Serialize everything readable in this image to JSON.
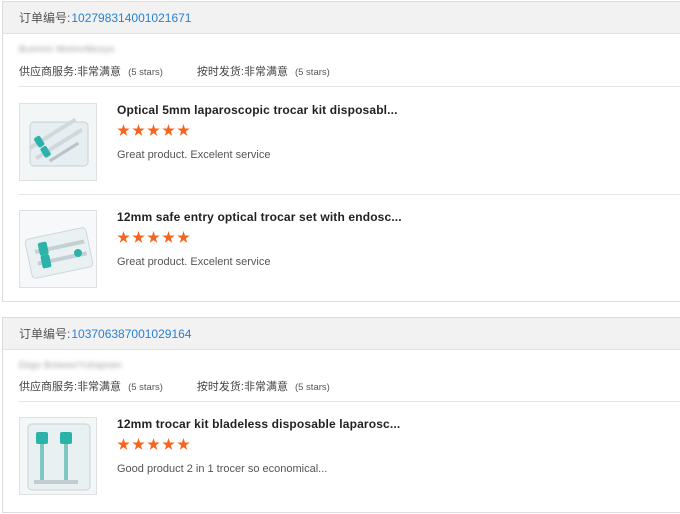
{
  "orders": [
    {
      "label": "订单编号:",
      "number": "102798314001021671",
      "buyer": "Buiimiin Motim/Mosyo",
      "supplier_label": "供应商服务:",
      "supplier_value": "非常满意",
      "supplier_stars": "(5 stars)",
      "delivery_label": "按时发货:",
      "delivery_value": "非常满意",
      "delivery_stars": "(5 stars)",
      "items": [
        {
          "title": "Optical 5mm laparoscopic trocar kit disposabl...",
          "rating": 5,
          "comment": "Great product. Excelent service"
        },
        {
          "title": "12mm safe entry optical trocar set with endosc...",
          "rating": 5,
          "comment": "Great product. Excelent service"
        }
      ]
    },
    {
      "label": "订单编号:",
      "number": "103706387001029164",
      "buyer": "Ekgo Bolwoo/Yuhajmen",
      "supplier_label": "供应商服务:",
      "supplier_value": "非常满意",
      "supplier_stars": "(5 stars)",
      "delivery_label": "按时发货:",
      "delivery_value": "非常满意",
      "delivery_stars": "(5 stars)",
      "items": [
        {
          "title": "12mm trocar kit bladeless disposable laparosc...",
          "rating": 5,
          "comment": "Good product 2 in 1 trocer so economical..."
        }
      ]
    }
  ],
  "colors": {
    "accent_link": "#2a7fd4",
    "star": "#f7641b",
    "header_bg": "#f2f2f2",
    "trocar_teal": "#2bb3a9"
  },
  "icons": {
    "rating": "star-icon"
  }
}
